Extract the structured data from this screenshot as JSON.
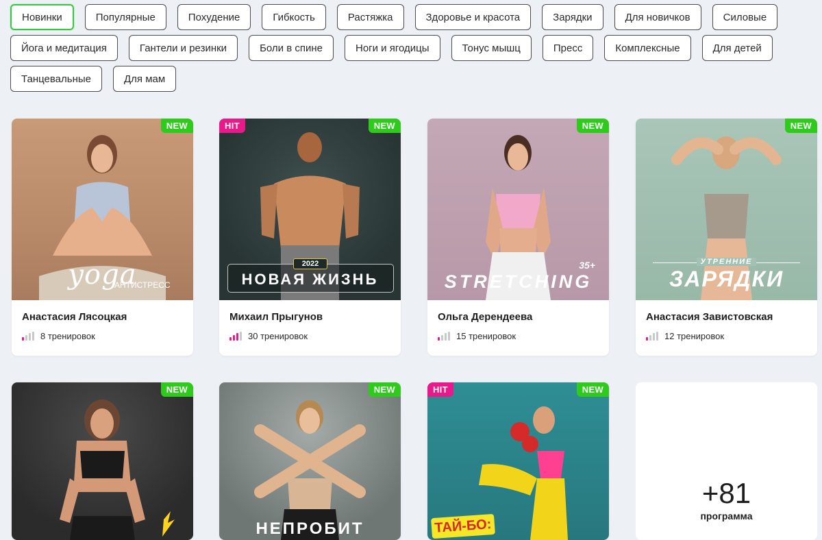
{
  "filters": [
    {
      "label": "Новинки",
      "active": true
    },
    {
      "label": "Популярные"
    },
    {
      "label": "Похудение"
    },
    {
      "label": "Гибкость"
    },
    {
      "label": "Растяжка"
    },
    {
      "label": "Здоровье и красота"
    },
    {
      "label": "Зарядки"
    },
    {
      "label": "Для новичков"
    },
    {
      "label": "Силовые"
    },
    {
      "label": "Йога и медитация"
    },
    {
      "label": "Гантели и резинки"
    },
    {
      "label": "Боли в спине"
    },
    {
      "label": "Ноги и ягодицы"
    },
    {
      "label": "Тонус мышц"
    },
    {
      "label": "Пресс"
    },
    {
      "label": "Комплексные"
    },
    {
      "label": "Для детей"
    },
    {
      "label": "Танцевальные"
    },
    {
      "label": "Для мам"
    }
  ],
  "badges": {
    "new": "NEW",
    "hit": "HIT"
  },
  "cards": [
    {
      "author": "Анастасия Лясоцкая",
      "workouts": "8 тренировок",
      "level": 1,
      "cover_title": "yoga",
      "cover_subtitle": "АНТИСТРЕСС"
    },
    {
      "author": "Михаил Прыгунов",
      "workouts": "30 тренировок",
      "level": 3,
      "cover_title": "НОВАЯ ЖИЗНЬ",
      "cover_subtitle": "2022"
    },
    {
      "author": "Ольга Дерендеева",
      "workouts": "15 тренировок",
      "level": 1,
      "cover_title": "STRETCHING",
      "cover_subtitle": "35+"
    },
    {
      "author": "Анастасия Завистовская",
      "workouts": "12 тренировок",
      "level": 1,
      "cover_title": "ЗАРЯДКИ",
      "cover_subtitle": "УТРЕННИЕ"
    },
    {
      "cover_title": ""
    },
    {
      "cover_title": "НЕПРОБИТ"
    },
    {
      "cover_title": "ТАЙ-БО:"
    }
  ],
  "more": {
    "count": "+81",
    "label": "программа"
  },
  "colors": {
    "accent_new": "#2fcb1c",
    "accent_hit": "#e8198b",
    "active_filter": "#39c54a"
  }
}
